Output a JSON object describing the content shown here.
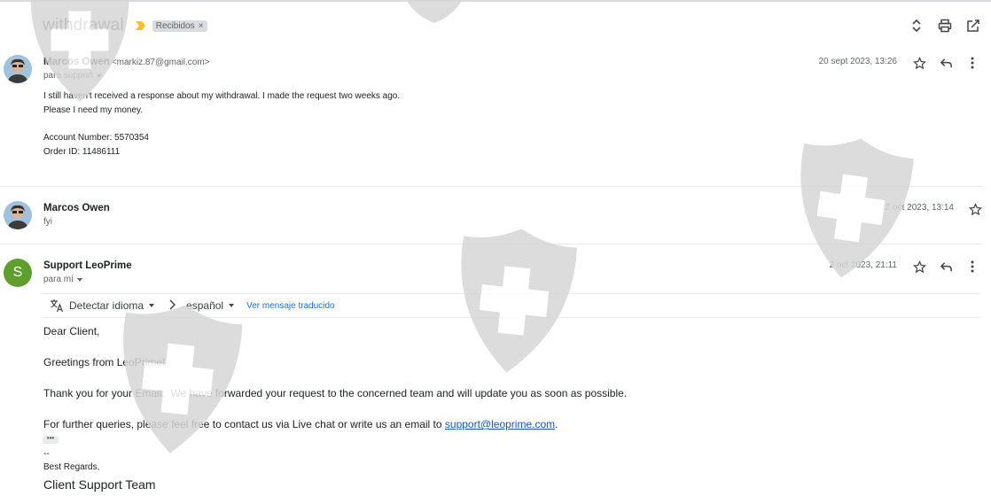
{
  "thread": {
    "subject": "withdrawal",
    "label": "Recibidos",
    "label_remove": "×"
  },
  "toolbar": {
    "expand_icon": "unfold-icon",
    "print_icon": "print-icon",
    "popout_icon": "open-new-window-icon"
  },
  "messages": [
    {
      "sender": "Marcos Owen",
      "email": "<markiz.87@gmail.com>",
      "to": "para support",
      "date": "20 sept 2023, 13:26",
      "body_lines": [
        "I still haven't received a response about my withdrawal. I made the request two weeks ago.",
        "Please I need my money.",
        "",
        "Account Number: 5570354",
        "Order ID: 11486111"
      ]
    },
    {
      "sender": "Marcos Owen",
      "snippet": "fyi",
      "date": "2 oct 2023, 13:14"
    },
    {
      "sender": "Support LeoPrime",
      "avatar_letter": "S",
      "avatar_color": "#5f9e2f",
      "to": "para mí",
      "date": "2 oct 2023, 21:11"
    }
  ],
  "translate": {
    "detect": "Detectar idioma",
    "target": "español",
    "view_translated": "Ver mensaje traducido"
  },
  "reply": {
    "greeting": "Dear Client,",
    "line1": "Greetings from LeoPrime!",
    "line2": "Thank you for your Email.  We have forwarded your request to the concerned team and will update you as soon as possible.",
    "line3_prefix": "For further queries, please feel free to contact us via Live chat or write us an email to ",
    "line3_link": "support@leoprime.com",
    "line3_suffix": ".",
    "ellipsis": "•••",
    "sig_dash": "--",
    "sig_regards": "Best Regards,",
    "sig_team": "Client Support Team"
  },
  "colors": {
    "accent_link": "#1155cc",
    "label_chip": "#dadce0",
    "watermark": "#cfcfcf",
    "importance": "#f6c026"
  }
}
